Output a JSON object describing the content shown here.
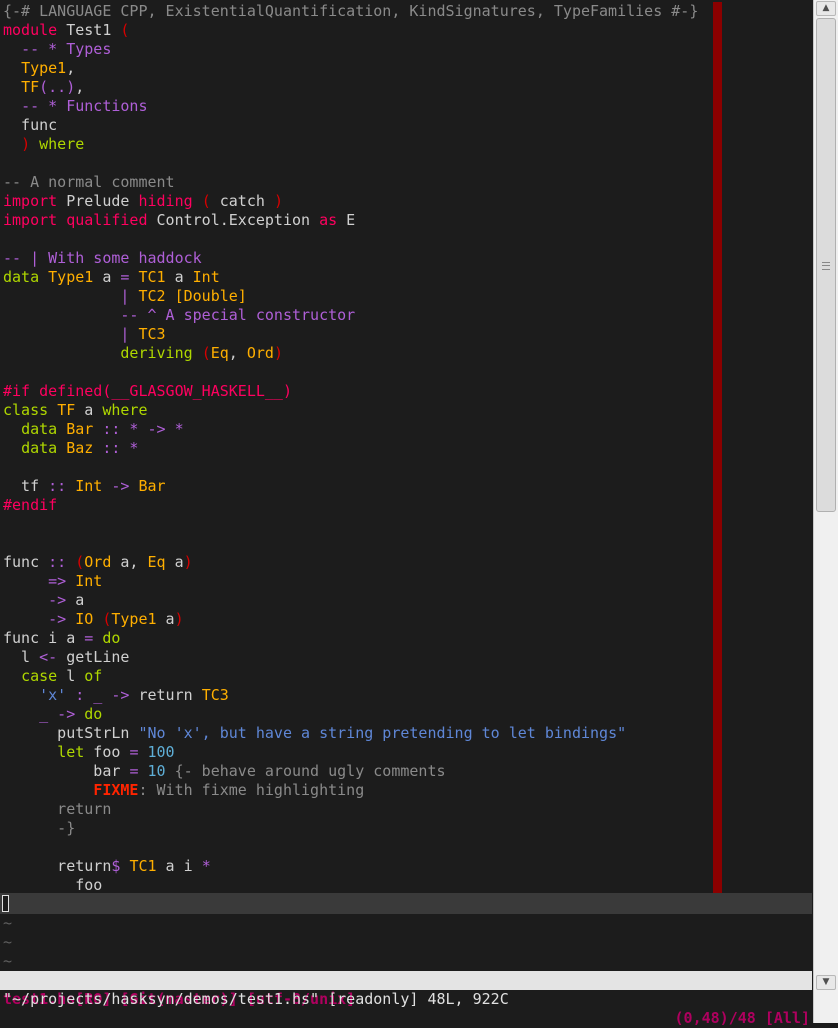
{
  "palette": {
    "default": "#d0d0d0",
    "pragma": "#8a8a8a",
    "comment": "#8a8a8a",
    "keyword": "#ff005f",
    "statement": "#afd700",
    "type": "#ffaf00",
    "doc": "#af5fd7",
    "string": "#5f87d7",
    "number": "#5fafd7",
    "operator": "#af5fd7",
    "preproc": "#ff005f",
    "paren": "#d70000",
    "todo": "#ff2400",
    "status_bg": "#e4e4e4",
    "status_fg": "#af005f",
    "colorcolumn": "#8b0000"
  },
  "code_lines": [
    [
      [
        "{-# LANGUAGE CPP, ExistentialQuantification, KindSignatures, TypeFamilies #-}",
        "pragma"
      ]
    ],
    [
      [
        "module",
        "keyword"
      ],
      [
        " Test1 ",
        "default"
      ],
      [
        "(",
        "paren"
      ]
    ],
    [
      [
        "  ",
        "default"
      ],
      [
        "-- * Types",
        "doc"
      ]
    ],
    [
      [
        "  ",
        "default"
      ],
      [
        "Type1",
        "type"
      ],
      [
        ",",
        "default"
      ]
    ],
    [
      [
        "  ",
        "default"
      ],
      [
        "TF",
        "type"
      ],
      [
        "(..)",
        "operator"
      ],
      [
        ",",
        "default"
      ]
    ],
    [
      [
        "  ",
        "default"
      ],
      [
        "-- * Functions",
        "doc"
      ]
    ],
    [
      [
        "  func",
        "default"
      ]
    ],
    [
      [
        "  ",
        "default"
      ],
      [
        ")",
        "paren"
      ],
      [
        " ",
        "default"
      ],
      [
        "where",
        "statement"
      ]
    ],
    [
      [
        "",
        "default"
      ]
    ],
    [
      [
        "-- A normal comment",
        "comment"
      ]
    ],
    [
      [
        "import",
        "keyword"
      ],
      [
        " Prelude ",
        "default"
      ],
      [
        "hiding",
        "keyword"
      ],
      [
        " ",
        "default"
      ],
      [
        "(",
        "paren"
      ],
      [
        " catch ",
        "default"
      ],
      [
        ")",
        "paren"
      ]
    ],
    [
      [
        "import",
        "keyword"
      ],
      [
        " ",
        "default"
      ],
      [
        "qualified",
        "keyword"
      ],
      [
        " Control.Exception ",
        "default"
      ],
      [
        "as",
        "keyword"
      ],
      [
        " E",
        "default"
      ]
    ],
    [
      [
        "",
        "default"
      ]
    ],
    [
      [
        "-- | With some haddock",
        "doc"
      ]
    ],
    [
      [
        "data",
        "statement"
      ],
      [
        " ",
        "default"
      ],
      [
        "Type1",
        "type"
      ],
      [
        " a ",
        "default"
      ],
      [
        "=",
        "operator"
      ],
      [
        " ",
        "default"
      ],
      [
        "TC1",
        "type"
      ],
      [
        " a ",
        "default"
      ],
      [
        "Int",
        "type"
      ]
    ],
    [
      [
        "             ",
        "default"
      ],
      [
        "|",
        "operator"
      ],
      [
        " ",
        "default"
      ],
      [
        "TC2",
        "type"
      ],
      [
        " ",
        "default"
      ],
      [
        "[Double]",
        "type"
      ]
    ],
    [
      [
        "             ",
        "default"
      ],
      [
        "-- ^ A special constructor",
        "doc"
      ]
    ],
    [
      [
        "             ",
        "default"
      ],
      [
        "|",
        "operator"
      ],
      [
        " ",
        "default"
      ],
      [
        "TC3",
        "type"
      ]
    ],
    [
      [
        "             ",
        "default"
      ],
      [
        "deriving",
        "statement"
      ],
      [
        " ",
        "default"
      ],
      [
        "(",
        "paren"
      ],
      [
        "Eq",
        "type"
      ],
      [
        ", ",
        "default"
      ],
      [
        "Ord",
        "type"
      ],
      [
        ")",
        "paren"
      ]
    ],
    [
      [
        "",
        "default"
      ]
    ],
    [
      [
        "#if defined(__GLASGOW_HASKELL__)",
        "preproc"
      ]
    ],
    [
      [
        "class",
        "statement"
      ],
      [
        " ",
        "default"
      ],
      [
        "TF",
        "type"
      ],
      [
        " a ",
        "default"
      ],
      [
        "where",
        "statement"
      ]
    ],
    [
      [
        "  ",
        "default"
      ],
      [
        "data",
        "statement"
      ],
      [
        " ",
        "default"
      ],
      [
        "Bar",
        "type"
      ],
      [
        " ",
        "default"
      ],
      [
        ":: * -> *",
        "operator"
      ]
    ],
    [
      [
        "  ",
        "default"
      ],
      [
        "data",
        "statement"
      ],
      [
        " ",
        "default"
      ],
      [
        "Baz",
        "type"
      ],
      [
        " ",
        "default"
      ],
      [
        ":: *",
        "operator"
      ]
    ],
    [
      [
        "",
        "default"
      ]
    ],
    [
      [
        "  tf ",
        "default"
      ],
      [
        "::",
        "operator"
      ],
      [
        " ",
        "default"
      ],
      [
        "Int",
        "type"
      ],
      [
        " ",
        "default"
      ],
      [
        "->",
        "operator"
      ],
      [
        " ",
        "default"
      ],
      [
        "Bar",
        "type"
      ]
    ],
    [
      [
        "#endif",
        "preproc"
      ]
    ],
    [
      [
        "",
        "default"
      ]
    ],
    [
      [
        "",
        "default"
      ]
    ],
    [
      [
        "func ",
        "default"
      ],
      [
        "::",
        "operator"
      ],
      [
        " ",
        "default"
      ],
      [
        "(",
        "paren"
      ],
      [
        "Ord",
        "type"
      ],
      [
        " a, ",
        "default"
      ],
      [
        "Eq",
        "type"
      ],
      [
        " a",
        "default"
      ],
      [
        ")",
        "paren"
      ]
    ],
    [
      [
        "     ",
        "default"
      ],
      [
        "=>",
        "operator"
      ],
      [
        " ",
        "default"
      ],
      [
        "Int",
        "type"
      ]
    ],
    [
      [
        "     ",
        "default"
      ],
      [
        "->",
        "operator"
      ],
      [
        " a",
        "default"
      ]
    ],
    [
      [
        "     ",
        "default"
      ],
      [
        "->",
        "operator"
      ],
      [
        " ",
        "default"
      ],
      [
        "IO",
        "type"
      ],
      [
        " ",
        "default"
      ],
      [
        "(",
        "paren"
      ],
      [
        "Type1",
        "type"
      ],
      [
        " a",
        "default"
      ],
      [
        ")",
        "paren"
      ]
    ],
    [
      [
        "func i a ",
        "default"
      ],
      [
        "=",
        "operator"
      ],
      [
        " ",
        "default"
      ],
      [
        "do",
        "statement"
      ]
    ],
    [
      [
        "  l ",
        "default"
      ],
      [
        "<-",
        "operator"
      ],
      [
        " getLine",
        "default"
      ]
    ],
    [
      [
        "  ",
        "default"
      ],
      [
        "case",
        "statement"
      ],
      [
        " l ",
        "default"
      ],
      [
        "of",
        "statement"
      ]
    ],
    [
      [
        "    ",
        "default"
      ],
      [
        "'x'",
        "string"
      ],
      [
        " ",
        "default"
      ],
      [
        ": _ ->",
        "operator"
      ],
      [
        " return ",
        "default"
      ],
      [
        "TC3",
        "type"
      ]
    ],
    [
      [
        "    ",
        "default"
      ],
      [
        "_ ->",
        "operator"
      ],
      [
        " ",
        "default"
      ],
      [
        "do",
        "statement"
      ]
    ],
    [
      [
        "      putStrLn ",
        "default"
      ],
      [
        "\"No 'x', but have a string pretending to let bindings\"",
        "string"
      ]
    ],
    [
      [
        "      ",
        "default"
      ],
      [
        "let",
        "statement"
      ],
      [
        " foo ",
        "default"
      ],
      [
        "=",
        "operator"
      ],
      [
        " ",
        "default"
      ],
      [
        "100",
        "number"
      ]
    ],
    [
      [
        "          bar ",
        "default"
      ],
      [
        "=",
        "operator"
      ],
      [
        " ",
        "default"
      ],
      [
        "10",
        "number"
      ],
      [
        " ",
        "default"
      ],
      [
        "{- behave around ugly comments",
        "comment"
      ]
    ],
    [
      [
        "          ",
        "default"
      ],
      [
        "FIXME",
        "todo"
      ],
      [
        ": With fixme highlighting",
        "comment"
      ]
    ],
    [
      [
        "      return",
        "comment"
      ]
    ],
    [
      [
        "      -}",
        "comment"
      ]
    ],
    [
      [
        "",
        "default"
      ]
    ],
    [
      [
        "      return",
        "default"
      ],
      [
        "$",
        "operator"
      ],
      [
        " ",
        "default"
      ],
      [
        "TC1",
        "type"
      ],
      [
        " a i ",
        "default"
      ],
      [
        "*",
        "operator"
      ]
    ],
    [
      [
        "        foo",
        "default"
      ]
    ]
  ],
  "tildes": [
    "~",
    "~",
    "~"
  ],
  "statusline": {
    "left": "test1.hs[RO] [Git(master)] [utf-8/unix]",
    "right": "(0,48)/48 [All]"
  },
  "cmdline": "\"~/projects/hasksyn/demos/test1.hs\" [readonly] 48L, 922C",
  "scrollbar": {
    "up_icon": "▲",
    "down_icon": "▼",
    "position_fraction": 0.0,
    "visible_fraction": 1.0
  }
}
